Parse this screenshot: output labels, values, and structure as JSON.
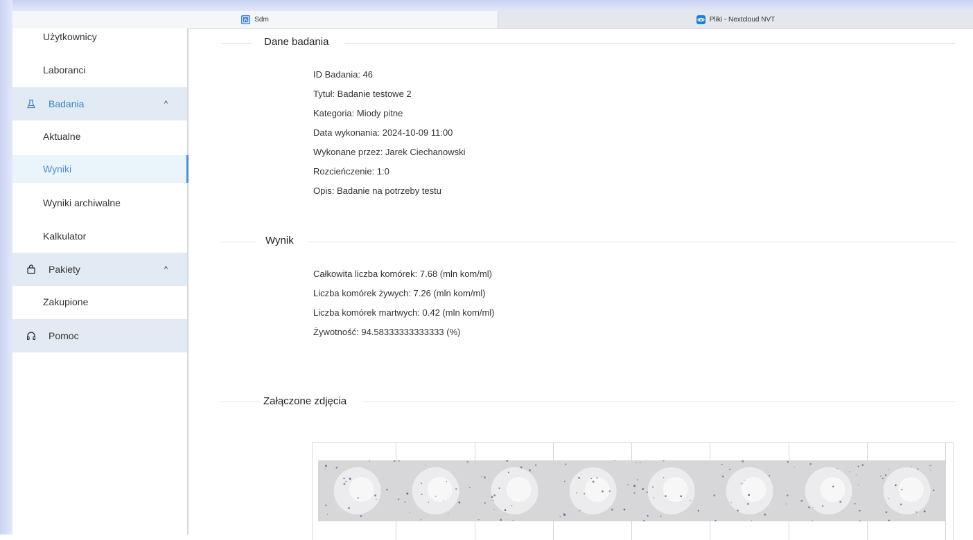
{
  "browser": {
    "tabs": [
      {
        "label": "Sdm",
        "icon": "app-icon"
      },
      {
        "label": "Pliki - Nextcloud NVT",
        "icon": "nextcloud-icon"
      }
    ]
  },
  "sidebar": {
    "items": {
      "uzytkownicy": "Użytkownicy",
      "laboranci": "Laboranci",
      "badania": "Badania",
      "aktualne": "Aktualne",
      "wyniki": "Wyniki",
      "wyniki_archiwalne": "Wyniki archiwalne",
      "kalkulator": "Kalkulator",
      "pakiety": "Pakiety",
      "zakupione": "Zakupione",
      "pomoc": "Pomoc"
    },
    "chevron_up": "^"
  },
  "study": {
    "title": "Dane badania",
    "id": "ID Badania: 46",
    "name": "Tytuł: Badanie testowe 2",
    "category": "Kategoria: Miody pitne",
    "date": "Data wykonania: 2024-10-09 11:00",
    "performed_by": "Wykonane przez: Jarek Ciechanowski",
    "dilution": "Rozcieńczenie: 1:0",
    "description": "Opis: Badanie na potrzeby testu"
  },
  "result": {
    "title": "Wynik",
    "total": "Całkowita liczba komórek: 7.68 (mln kom/ml)",
    "alive": "Liczba komórek żywych: 7.26 (mln kom/ml)",
    "dead": "Liczba komórek martwych: 0.42 (mln kom/ml)",
    "viability": "Żywotność: 94.58333333333333 (%)"
  },
  "photos": {
    "title": "Załączone zdjęcia",
    "count": 8
  },
  "colors": {
    "accent": "#4a8fd1",
    "group_bg": "#e2ebf3",
    "active_bg": "#eaf4fb"
  }
}
